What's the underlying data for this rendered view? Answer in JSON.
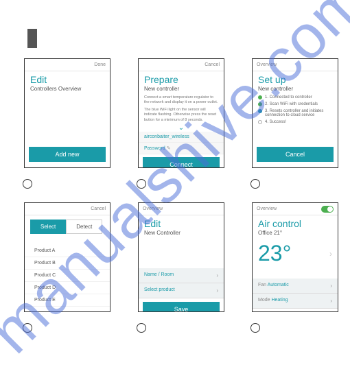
{
  "watermark": "manualshive.com",
  "screens": {
    "s1": {
      "hdr_r": "Done",
      "title": "Edit",
      "sub": "Controllers Overview",
      "btn": "Add new"
    },
    "s2": {
      "hdr_r": "Cancel",
      "title": "Prepare",
      "sub": "New controller",
      "t1": "Connect a smart temperature regulator to the network and display it on a power outlet.",
      "t2": "The blue WiFi light on the sensor will indicate flashing. Otherwise press the reset button for a minimum of 8 seconds.",
      "f1": "airconbaiter_wireless",
      "f2": "Password",
      "btn": "Connect"
    },
    "s3": {
      "hdr_l": "Overview",
      "title": "Set up",
      "sub": "New controller",
      "st1": "1. Connected to controller",
      "st2": "2. Scan WiFi with credentials",
      "st3": "3. Resets controller and initiates connection to cloud service",
      "st4": "4. Success!",
      "btn": "Cancel"
    },
    "s4": {
      "hdr_r": "Cancel",
      "tab1": "Select",
      "tab2": "Detect",
      "p1": "Product A",
      "p2": "Product B",
      "p3": "Product C",
      "p4": "Product D",
      "p5": "Product E"
    },
    "s5": {
      "hdr_l": "Overview",
      "title": "Edit",
      "sub": "New Controller",
      "r1": "Name / Room",
      "r2": "Select product",
      "btn": "Save"
    },
    "s6": {
      "hdr_l": "Overview",
      "title": "Air control",
      "sub": "Office 21°",
      "temp": "23°",
      "r1l": "Fan",
      "r1v": "Automatic",
      "r2l": "Mode",
      "r2v": "Heating"
    }
  }
}
